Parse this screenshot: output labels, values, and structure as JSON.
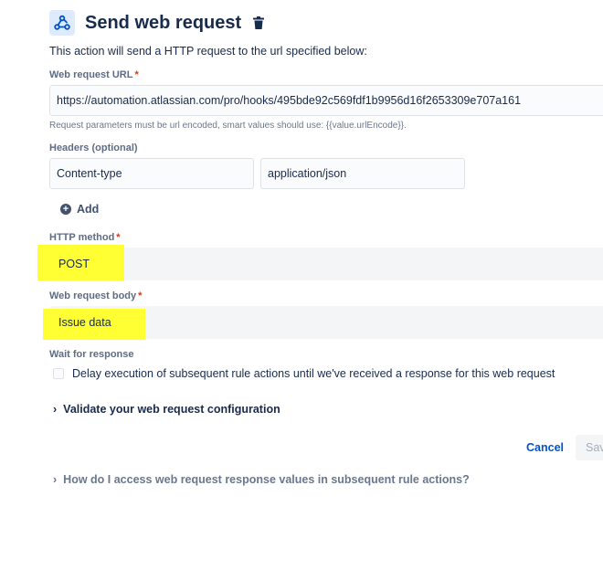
{
  "header": {
    "title": "Send web request",
    "webhook_icon": "webhook-icon",
    "delete_icon": "trash-icon",
    "icon_bg": "#deebff",
    "icon_color": "#0052cc"
  },
  "description": "This action will send a HTTP request to the url specified below:",
  "url_field": {
    "label": "Web request URL",
    "required_mark": "*",
    "value": "https://automation.atlassian.com/pro/hooks/495bde92c569fdf1b9956d16f2653309e707a161",
    "helper": "Request parameters must be url encoded, smart values should use: {{value.urlEncode}}."
  },
  "headers": {
    "label": "Headers (optional)",
    "rows": [
      {
        "key": "Content-type",
        "value": "application/json"
      }
    ],
    "add_label": "Add",
    "add_icon": "plus-circle-icon"
  },
  "http_method": {
    "label": "HTTP method",
    "required_mark": "*",
    "selected": "POST"
  },
  "body": {
    "label": "Web request body",
    "required_mark": "*",
    "selected": "Issue data"
  },
  "wait": {
    "label": "Wait for response",
    "checkbox_label": "Delay execution of subsequent rule actions until we've received a response for this web request",
    "checked": false
  },
  "validate": {
    "label": "Validate your web request configuration",
    "chevron_icon": "chevron-right-icon"
  },
  "actions": {
    "cancel": "Cancel",
    "save": "Save",
    "accent": "#0052cc"
  },
  "help": {
    "label": "How do I access web request response values in subsequent rule actions?",
    "chevron_icon": "chevron-right-icon"
  },
  "highlight_color": "#ffff33"
}
